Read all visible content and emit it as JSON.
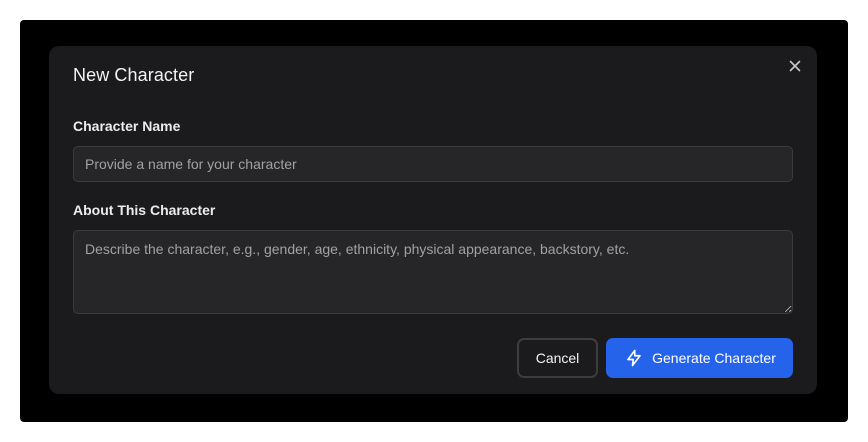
{
  "dialog": {
    "title": "New Character",
    "close_icon": "close-icon"
  },
  "fields": {
    "name": {
      "label": "Character Name",
      "value": "",
      "placeholder": "Provide a name for your character"
    },
    "about": {
      "label": "About This Character",
      "value": "",
      "placeholder": "Describe the character, e.g., gender, age, ethnicity, physical appearance, backstory, etc."
    }
  },
  "actions": {
    "cancel_label": "Cancel",
    "generate_label": "Generate Character",
    "generate_icon": "lightning-bolt-icon"
  },
  "colors": {
    "dialog_background": "#1b1b1d",
    "input_background": "#262628",
    "primary_accent": "#2563eb",
    "text_primary": "#f4f4f5",
    "placeholder_text": "#a1a1a6"
  }
}
